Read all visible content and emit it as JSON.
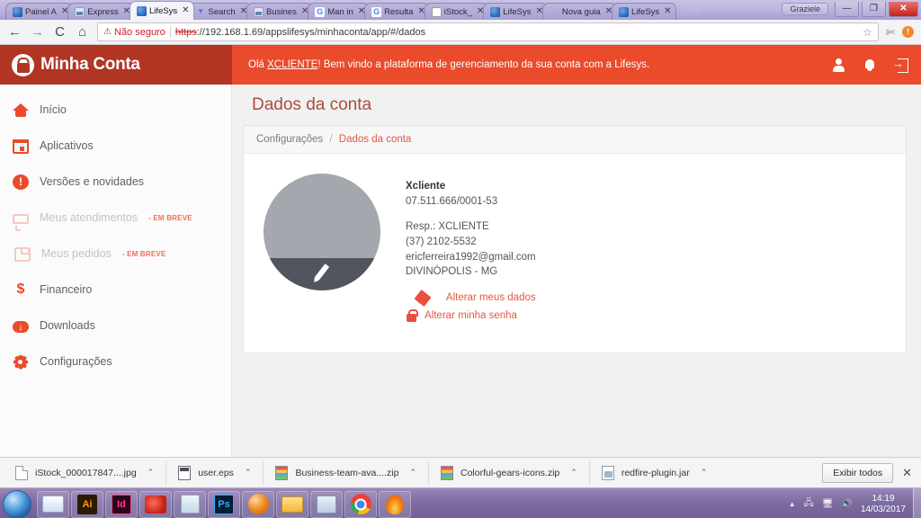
{
  "browser": {
    "tabs": [
      {
        "title": "Painel A",
        "favicon": "fav-blue",
        "active": false
      },
      {
        "title": "Express",
        "favicon": "fav-img",
        "active": false
      },
      {
        "title": "LifeSys",
        "favicon": "fav-blue",
        "active": true
      },
      {
        "title": "Search",
        "favicon": "fav-search",
        "active": false
      },
      {
        "title": "Busines",
        "favicon": "fav-img",
        "active": false
      },
      {
        "title": "Man in",
        "favicon": "fav-g",
        "active": false
      },
      {
        "title": "Resulta",
        "favicon": "fav-g",
        "active": false
      },
      {
        "title": "iStock_",
        "favicon": "fav-doc",
        "active": false
      },
      {
        "title": "LifeSys",
        "favicon": "fav-blue",
        "active": false
      },
      {
        "title": "Nova guia",
        "favicon": "fav-none",
        "active": false
      },
      {
        "title": "LifeSys",
        "favicon": "fav-blue",
        "active": false
      }
    ],
    "tab_close_glyph": "✕",
    "window": {
      "user": "Graziele",
      "minimize": "—",
      "maximize": "❐",
      "close": "✕"
    },
    "nav": {
      "back": "←",
      "forward": "→",
      "reload": "C",
      "home": "⌂"
    },
    "omnibox": {
      "warning_icon": "⚠",
      "warning_label": "Não seguro",
      "url_scheme": "https",
      "url_rest": "://192.168.1.69/appslifesys/minhaconta/app/#/dados",
      "star_icon": "☆",
      "extension_icon": "✄",
      "alert_icon": "!"
    }
  },
  "app": {
    "logo_text": "Minha Conta",
    "greeting_prefix": "Olá ",
    "greeting_user": "XCLIENTE",
    "greeting_suffix": "! Bem vindo a plataforma de gerenciamento da sua conta com a Lifesys.",
    "header_icons": [
      {
        "name": "user-icon",
        "label": "Usuário"
      },
      {
        "name": "bell-icon",
        "label": "Notificações"
      },
      {
        "name": "logout-icon",
        "label": "Sair"
      }
    ],
    "colors": {
      "logo_panel": "#b03523",
      "header_bar": "#ea4b2a",
      "accent": "#e05a43",
      "title": "#b14a3c",
      "soon_badge": "#f0705a"
    }
  },
  "sidebar": {
    "items": [
      {
        "label": "Início",
        "icon": "ic-home",
        "disabled": false,
        "badge": ""
      },
      {
        "label": "Aplicativos",
        "icon": "ic-cal",
        "disabled": false,
        "badge": ""
      },
      {
        "label": "Versões e novidades",
        "icon": "ic-alert",
        "disabled": false,
        "badge": ""
      },
      {
        "label": "Meus atendimentos",
        "icon": "ic-chat",
        "disabled": true,
        "badge": "- EM BREVE"
      },
      {
        "label": "Meus pedidos",
        "icon": "ic-clip",
        "disabled": true,
        "badge": "- EM BREVE"
      },
      {
        "label": "Financeiro",
        "icon": "ic-dollar",
        "disabled": false,
        "badge": ""
      },
      {
        "label": "Downloads",
        "icon": "ic-cloud",
        "disabled": false,
        "badge": ""
      },
      {
        "label": "Configurações",
        "icon": "ic-gear",
        "disabled": false,
        "badge": ""
      }
    ]
  },
  "main": {
    "page_title": "Dados da conta",
    "breadcrumb": {
      "parent": "Configurações",
      "separator": "/",
      "current": "Dados da conta"
    },
    "account": {
      "name": "Xcliente",
      "document": "07.511.666/0001-53",
      "responsible": "Resp.: XCLIENTE",
      "phone": "(37) 2102-5532",
      "email": "ericferreira1992@gmail.com",
      "city": "DIVINÓPOLIS - MG"
    },
    "actions": [
      {
        "label": "Alterar meus dados",
        "icon": "a-pencil"
      },
      {
        "label": "Alterar minha senha",
        "icon": "a-lock"
      }
    ]
  },
  "downloads": {
    "items": [
      {
        "name": "iStock_000017847....jpg",
        "icon": "fi-generic"
      },
      {
        "name": "user.eps",
        "icon": "fi-eps"
      },
      {
        "name": "Business-team-ava....zip",
        "icon": "fi-zip"
      },
      {
        "name": "Colorful-gears-icons.zip",
        "icon": "fi-zip"
      },
      {
        "name": "redfire-plugin.jar",
        "icon": "fi-jar"
      }
    ],
    "caret": "⌃",
    "show_all": "Exibir todos",
    "close": "✕"
  },
  "taskbar": {
    "apps": [
      {
        "name": "explorer",
        "cls": "tb-explorer",
        "label": ""
      },
      {
        "name": "illustrator",
        "cls": "tb-ai",
        "label": "Ai"
      },
      {
        "name": "indesign",
        "cls": "tb-id",
        "label": "Id"
      },
      {
        "name": "ccleaner",
        "cls": "tb-clean",
        "label": ""
      },
      {
        "name": "calculator",
        "cls": "tb-calc",
        "label": ""
      },
      {
        "name": "photoshop",
        "cls": "tb-ps",
        "label": "Ps"
      },
      {
        "name": "sphere-app",
        "cls": "tb-sphere",
        "label": ""
      },
      {
        "name": "folder",
        "cls": "tb-folder",
        "label": ""
      },
      {
        "name": "robot-app",
        "cls": "tb-robot",
        "label": ""
      },
      {
        "name": "chrome",
        "cls": "tb-chrome",
        "label": ""
      },
      {
        "name": "flame-app",
        "cls": "tb-flame",
        "label": ""
      }
    ],
    "tray": {
      "arrow": "▲",
      "network": "🖧",
      "share": "🖥",
      "volume": "🔊"
    },
    "time": "14:19",
    "date": "14/03/2017"
  }
}
